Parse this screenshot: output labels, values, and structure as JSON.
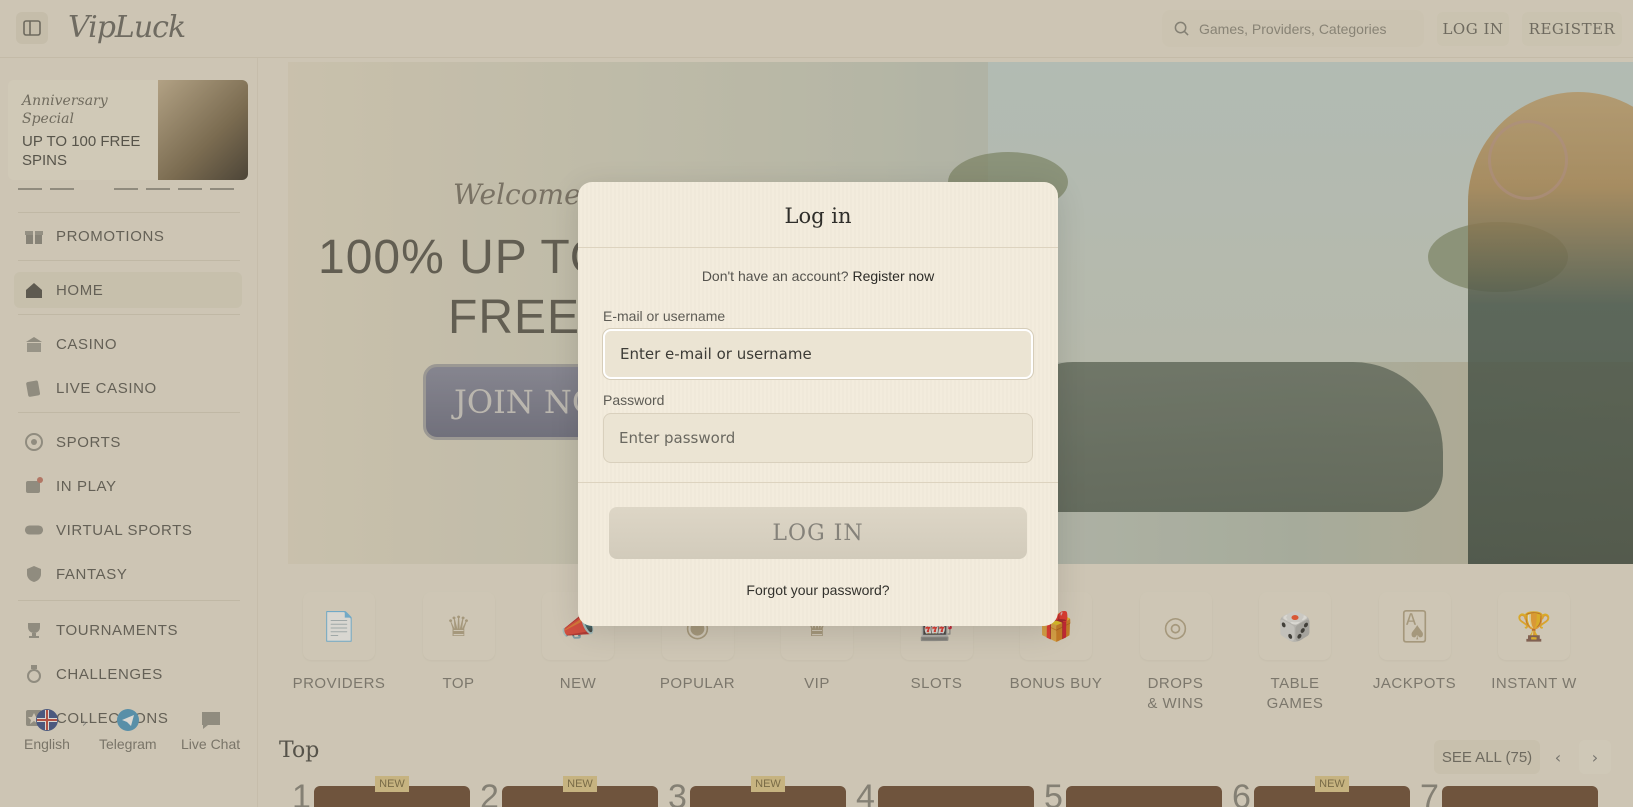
{
  "header": {
    "logo": "VipLuck",
    "search_placeholder": "Games, Providers, Categories",
    "login_label": "LOG IN",
    "register_label": "REGISTER"
  },
  "sidebar": {
    "promo": {
      "line1": "Anniversary Special",
      "line2": "UP TO 100 FREE SPINS"
    },
    "items": [
      {
        "label": "PROMOTIONS",
        "icon": "gift-icon"
      },
      {
        "label": "HOME",
        "icon": "home-icon",
        "active": true
      },
      {
        "label": "CASINO",
        "icon": "casino-icon"
      },
      {
        "label": "LIVE CASINO",
        "icon": "live-casino-icon"
      },
      {
        "label": "SPORTS",
        "icon": "soccer-ball-icon"
      },
      {
        "label": "IN PLAY",
        "icon": "in-play-icon"
      },
      {
        "label": "VIRTUAL SPORTS",
        "icon": "gamepad-icon"
      },
      {
        "label": "FANTASY",
        "icon": "shield-icon"
      },
      {
        "label": "TOURNAMENTS",
        "icon": "trophy-icon"
      },
      {
        "label": "CHALLENGES",
        "icon": "medal-icon"
      },
      {
        "label": "COLLECTIONS",
        "icon": "collection-icon"
      }
    ],
    "bottom": [
      {
        "label": "English",
        "icon": "uk-flag-icon"
      },
      {
        "label": "Telegram",
        "icon": "telegram-icon"
      },
      {
        "label": "Live Chat",
        "icon": "chat-icon"
      }
    ]
  },
  "hero": {
    "welcome": "Welcome P",
    "line1": "100% UP TO €2",
    "line2": "FREE SP",
    "cta": "JOIN NO"
  },
  "categories": [
    {
      "label": "PROVIDERS"
    },
    {
      "label": "TOP"
    },
    {
      "label": "NEW"
    },
    {
      "label": "POPULAR"
    },
    {
      "label": "VIP"
    },
    {
      "label": "SLOTS"
    },
    {
      "label": "BONUS BUY"
    },
    {
      "label": "DROPS & WINS"
    },
    {
      "label": "TABLE GAMES"
    },
    {
      "label": "JACKPOTS"
    },
    {
      "label": "INSTANT W"
    }
  ],
  "top_section": {
    "title": "Top",
    "see_all": "SEE ALL (75)",
    "new_badge": "NEW",
    "ranks": [
      "1",
      "2",
      "3",
      "4",
      "5",
      "6",
      "7"
    ]
  },
  "modal": {
    "title": "Log in",
    "no_account": "Don't have an account?",
    "register_link": "Register now",
    "email_label": "E-mail or username",
    "email_placeholder": "Enter e-mail or username",
    "password_label": "Password",
    "password_placeholder": "Enter password",
    "login_button": "LOG IN",
    "forgot": "Forgot your password?"
  }
}
